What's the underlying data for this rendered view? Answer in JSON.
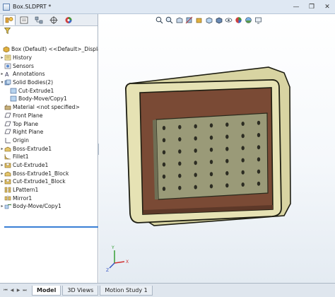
{
  "window": {
    "title": "Box.SLDPRT *",
    "minimize": "—",
    "restore": "❐",
    "close": "✕"
  },
  "feature_tree": {
    "root": "Box (Default) <<Default>_Display St",
    "items": [
      {
        "label": "History",
        "icon": "history-icon",
        "expandable": true
      },
      {
        "label": "Sensors",
        "icon": "sensors-icon",
        "expandable": false
      },
      {
        "label": "Annotations",
        "icon": "annotations-icon",
        "expandable": true
      },
      {
        "label": "Solid Bodies(2)",
        "icon": "solid-bodies-icon",
        "expandable": true
      },
      {
        "label": "Cut-Extrude1",
        "icon": "body-icon",
        "expandable": false,
        "indent": 1
      },
      {
        "label": "Body-Move/Copy1",
        "icon": "body-icon",
        "expandable": false,
        "indent": 1
      },
      {
        "label": "Material <not specified>",
        "icon": "material-icon",
        "expandable": false
      },
      {
        "label": "Front Plane",
        "icon": "plane-icon",
        "expandable": false
      },
      {
        "label": "Top Plane",
        "icon": "plane-icon",
        "expandable": false
      },
      {
        "label": "Right Plane",
        "icon": "plane-icon",
        "expandable": false
      },
      {
        "label": "Origin",
        "icon": "origin-icon",
        "expandable": false
      },
      {
        "label": "Boss-Extrude1",
        "icon": "extrude-icon",
        "expandable": true
      },
      {
        "label": "Fillet1",
        "icon": "fillet-icon",
        "expandable": false
      },
      {
        "label": "Cut-Extrude1",
        "icon": "cut-icon",
        "expandable": true
      },
      {
        "label": "Boss-Extrude1_Block",
        "icon": "extrude-icon",
        "expandable": true
      },
      {
        "label": "Cut-Extrude1_Block",
        "icon": "cut-icon",
        "expandable": true
      },
      {
        "label": "LPattern1",
        "icon": "pattern-icon",
        "expandable": false
      },
      {
        "label": "Mirror1",
        "icon": "mirror-icon",
        "expandable": false
      },
      {
        "label": "Body-Move/Copy1",
        "icon": "move-copy-icon",
        "expandable": true
      }
    ]
  },
  "bottom_tabs": [
    "Model",
    "3D Views",
    "Motion Study 1"
  ],
  "active_tab": "Model",
  "colors": {
    "box_frame": "#e6e2b4",
    "box_frame_edge": "#2a2a18",
    "box_inner": "#7a4a35",
    "plate": "#9a9a78",
    "hole": "#2c2c22",
    "accent": "#3a7fd5"
  },
  "triad": {
    "x": "X",
    "y": "Y",
    "z": "Z"
  }
}
